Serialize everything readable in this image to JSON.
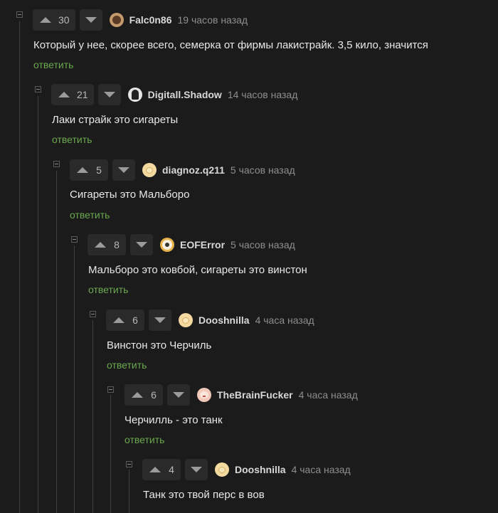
{
  "comments": [
    {
      "score": "30",
      "user": "Falc0n86",
      "time": "19 часов назад",
      "text": "Который у нее, скорее всего, семерка от фирмы лакистрайк. 3,5 кило, значится",
      "reply": "ответить",
      "avatar_color": "#c49a6c"
    },
    {
      "score": "21",
      "user": "Digitall.Shadow",
      "time": "14 часов назад",
      "text": "Лаки страйк это сигареты",
      "reply": "ответить",
      "avatar_color": "#e6e6e6"
    },
    {
      "score": "5",
      "user": "diagnoz.q211",
      "time": "5 часов назад",
      "text": "Сигареты это Мальборо",
      "reply": "ответить",
      "avatar_color": "#f3d9a0"
    },
    {
      "score": "8",
      "user": "EOFError",
      "time": "5 часов назад",
      "text": "Мальборо это ковбой, сигареты это винстон",
      "reply": "ответить",
      "avatar_color": "#e8b24a"
    },
    {
      "score": "6",
      "user": "Dooshnilla",
      "time": "4 часа назад",
      "text": "Винстон это Черчиль",
      "reply": "ответить",
      "avatar_color": "#f3d9a0"
    },
    {
      "score": "6",
      "user": "TheBrainFucker",
      "time": "4 часа назад",
      "text": "Черчилль - это танк",
      "reply": "ответить",
      "avatar_color": "#f2c9b8"
    },
    {
      "score": "4",
      "user": "Dooshnilla",
      "time": "4 часа назад",
      "text": "Танк это твой перс в вов",
      "reply": "",
      "avatar_color": "#f3d9a0"
    }
  ]
}
